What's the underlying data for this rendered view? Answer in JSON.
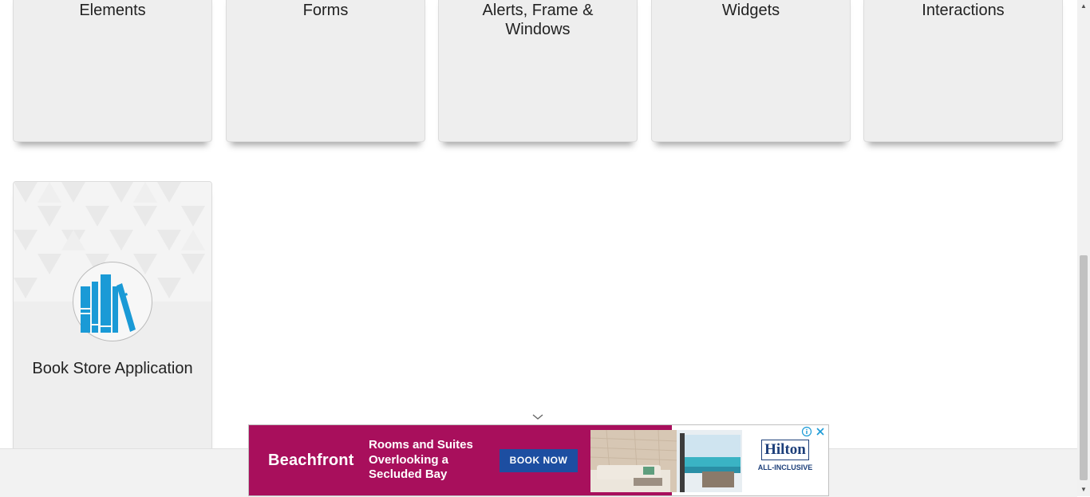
{
  "cards": [
    {
      "title": "Elements"
    },
    {
      "title": "Forms"
    },
    {
      "title": "Alerts, Frame & Windows"
    },
    {
      "title": "Widgets"
    },
    {
      "title": "Interactions"
    },
    {
      "title": "Book Store Application",
      "icon": "books-icon"
    }
  ],
  "ad": {
    "brand": "Beachfront",
    "headline": "Rooms and Suites Overlooking a Secluded Bay",
    "cta": "BOOK NOW",
    "logo": "Hilton",
    "logo_sub": "ALL-INCLUSIVE",
    "background_color": "#a80f5c",
    "cta_color": "#1d4ea1",
    "info_icon": "info-icon",
    "close_icon": "close-icon"
  },
  "colors": {
    "card_bg": "#eeeeee",
    "book_icon_blue": "#1a9ad6"
  }
}
